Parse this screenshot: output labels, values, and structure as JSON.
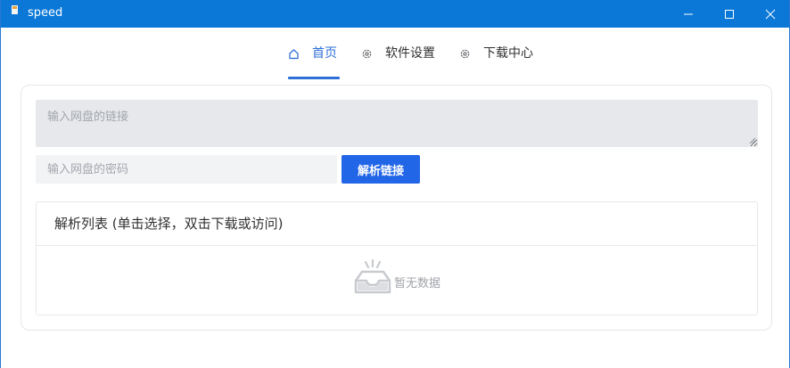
{
  "window": {
    "title": "speed",
    "controls": {
      "minimize_icon": "minimize-icon",
      "maximize_icon": "maximize-icon",
      "close_icon": "close-icon"
    },
    "titlebar_color": "#0b78d7"
  },
  "nav": {
    "tabs": [
      {
        "label": "首页",
        "icon": "home-icon",
        "active": true
      },
      {
        "label": "软件设置",
        "icon": "gear-icon",
        "active": false
      },
      {
        "label": "下载中心",
        "icon": "gear-icon",
        "active": false
      }
    ],
    "accent_color": "#2f6fd8"
  },
  "form": {
    "link_placeholder": "输入网盘的链接",
    "link_value": "",
    "password_placeholder": "输入网盘的密码",
    "password_value": "",
    "parse_button_label": "解析链接",
    "button_color": "#2266e8"
  },
  "list": {
    "header": "解析列表 (单击选择，双击下载或访问)",
    "empty_text": "暂无数据",
    "empty_icon": "empty-inbox-icon"
  }
}
